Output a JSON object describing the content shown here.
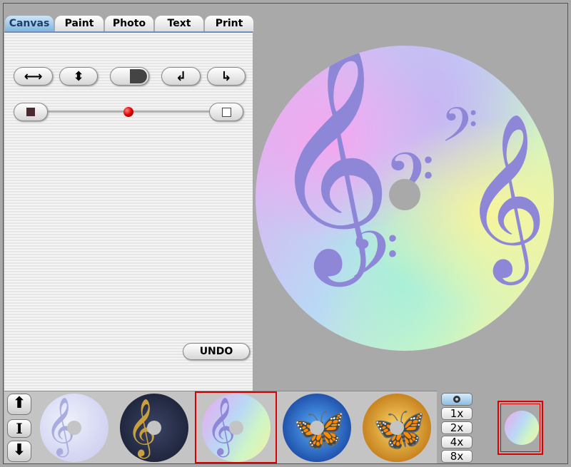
{
  "tabs": [
    {
      "label": "Canvas",
      "active": true
    },
    {
      "label": "Paint"
    },
    {
      "label": "Photo"
    },
    {
      "label": "Text"
    },
    {
      "label": "Print"
    }
  ],
  "toolbar": {
    "flip_horizontal": "⟷",
    "flip_vertical": "⬍",
    "rotate_left": "↲",
    "rotate_right": "↳"
  },
  "slider": {
    "value_percent": 50
  },
  "undo_label": "UNDO",
  "strip": {
    "up": "⬆",
    "insert": "I",
    "down": "⬇",
    "selected_index": 2
  },
  "zoom": {
    "options": [
      "1x",
      "2x",
      "4x",
      "8x"
    ],
    "view_icon": "disc-icon"
  },
  "colors": {
    "accent": "#7fb4dc",
    "selection": "#d00000",
    "knob": "#d00000"
  }
}
